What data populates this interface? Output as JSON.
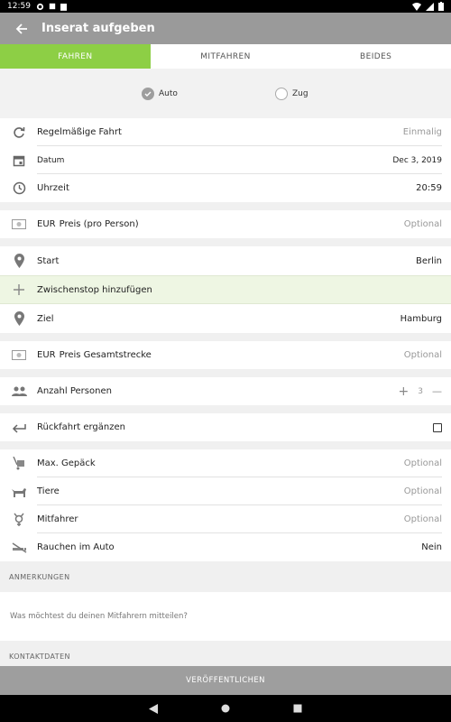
{
  "status_bar": {
    "time": "12:59"
  },
  "app_bar": {
    "title": "Inserat aufgeben"
  },
  "tabs": [
    {
      "label": "FAHREN",
      "active": true
    },
    {
      "label": "MITFAHREN",
      "active": false
    },
    {
      "label": "BEIDES",
      "active": false
    }
  ],
  "mode": {
    "auto_label": "Auto",
    "train_label": "Zug",
    "selected": "Auto"
  },
  "schedule": {
    "recurring_label": "Regelmäßige Fahrt",
    "recurring_value": "Einmalig",
    "date_label": "Datum",
    "date_value": "Dec 3, 2019",
    "time_label": "Uhrzeit",
    "time_value": "20:59"
  },
  "price": {
    "currency": "EUR",
    "label": "Preis (pro Person)",
    "value": "Optional"
  },
  "route": {
    "start_label": "Start",
    "start_value": "Berlin",
    "stopover_label": "Zwischenstop hinzufügen",
    "dest_label": "Ziel",
    "dest_value": "Hamburg"
  },
  "total_price": {
    "currency": "EUR",
    "label": "Preis Gesamtstrecke",
    "value": "Optional"
  },
  "persons": {
    "label": "Anzahl Personen",
    "count": "3",
    "plus": "+",
    "minus": "—"
  },
  "return_trip": {
    "label": "Rückfahrt ergänzen"
  },
  "extras": {
    "luggage_label": "Max. Gepäck",
    "luggage_value": "Optional",
    "pets_label": "Tiere",
    "pets_value": "Optional",
    "companions_label": "Mitfahrer",
    "companions_value": "Optional",
    "smoking_label": "Rauchen im Auto",
    "smoking_value": "Nein"
  },
  "remarks": {
    "header": "ANMERKUNGEN",
    "placeholder": "Was möchtest du deinen Mitfahrern mitteilen?"
  },
  "contact": {
    "header": "KONTAKTDATEN"
  },
  "publish_label": "VERÖFFENTLICHEN",
  "colors": {
    "accent": "#8dcf45",
    "appbar": "#9a9a9a",
    "green_row": "#eef6e3"
  }
}
